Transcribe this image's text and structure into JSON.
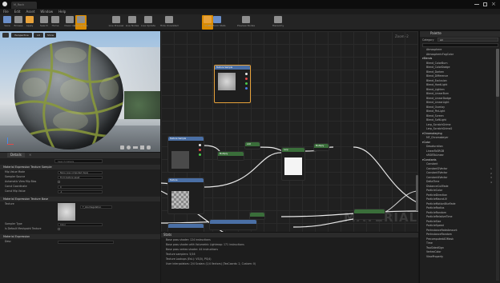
{
  "titlebar": {
    "tab": "M_Rock"
  },
  "menu": [
    "File",
    "Edit",
    "Asset",
    "Window",
    "Help"
  ],
  "toolbar": [
    {
      "label": "Save",
      "icon": "save-icon"
    },
    {
      "label": "Browse",
      "icon": "browse-icon"
    },
    {
      "label": "Apply",
      "icon": "apply-icon"
    },
    {
      "label": "Search",
      "icon": "search-icon"
    },
    {
      "label": "Home",
      "icon": "home-icon"
    },
    {
      "label": "Clean Up",
      "icon": "clean-up-icon"
    },
    {
      "label": "Connectors",
      "icon": "connectors-icon"
    },
    {
      "label": "Live Preview",
      "icon": "live-preview-icon"
    },
    {
      "label": "Live Nodes",
      "icon": "live-nodes-icon"
    },
    {
      "label": "Live Update",
      "icon": "live-update-icon"
    },
    {
      "label": "Hide Unrelated",
      "icon": "hide-unrelated-icon"
    },
    {
      "label": "Stats",
      "icon": "stats-icon"
    },
    {
      "label": "Platform Stats",
      "icon": "platform-stats-icon"
    },
    {
      "label": "Preview Nodes",
      "icon": "preview-nodes-icon"
    },
    {
      "label": "Hierarchy",
      "icon": "hierarchy-icon"
    }
  ],
  "viewport": {
    "mode": "Perspective",
    "lit": "Lit",
    "show": "Show"
  },
  "graph": {
    "zoom": "Zoom -2",
    "watermark": "MATERIAL"
  },
  "details": {
    "tab": "Details",
    "search_placeholder": "Search Details",
    "sections": [
      {
        "title": "Material Expression Texture Sample",
        "rows": [
          {
            "label": "Mip Value Mode",
            "value": "None (use computed mips)"
          },
          {
            "label": "Sampler Source",
            "value": "From texture asset"
          },
          {
            "label": "Automatic View Mip Bias",
            "value": ""
          },
          {
            "label": "Const Coordinate",
            "value": "0"
          },
          {
            "label": "Const Mip Value",
            "value": "-1"
          }
        ]
      },
      {
        "title": "Material Expression Texture Base",
        "rows": [
          {
            "label": "Texture",
            "value": "T_AlienVegetation"
          },
          {
            "label": "Sampler Type",
            "value": "Color"
          },
          {
            "label": "Is Default Meshpaint Texture",
            "value": ""
          }
        ]
      },
      {
        "title": "Material Expression",
        "rows": [
          {
            "label": "Desc",
            "value": ""
          }
        ]
      }
    ]
  },
  "palette": {
    "tab": "Palette",
    "category_label": "Category",
    "category_value": "All",
    "items": [
      {
        "cat": false,
        "text": "Atmosphere"
      },
      {
        "cat": false,
        "text": "AtmosphericFogColor"
      },
      {
        "cat": true,
        "text": "Blends"
      },
      {
        "cat": false,
        "text": "Blend_ColorBurn"
      },
      {
        "cat": false,
        "text": "Blend_ColorDodge"
      },
      {
        "cat": false,
        "text": "Blend_Darken"
      },
      {
        "cat": false,
        "text": "Blend_Difference"
      },
      {
        "cat": false,
        "text": "Blend_Exclusion"
      },
      {
        "cat": false,
        "text": "Blend_HardLight"
      },
      {
        "cat": false,
        "text": "Blend_Lighten"
      },
      {
        "cat": false,
        "text": "Blend_LinearBurn"
      },
      {
        "cat": false,
        "text": "Blend_LinearDodge"
      },
      {
        "cat": false,
        "text": "Blend_LinearLight"
      },
      {
        "cat": false,
        "text": "Blend_Overlay"
      },
      {
        "cat": false,
        "text": "Blend_PinLight"
      },
      {
        "cat": false,
        "text": "Blend_Screen"
      },
      {
        "cat": false,
        "text": "Blend_SoftLight"
      },
      {
        "cat": false,
        "text": "Lerp_ScratchGrime"
      },
      {
        "cat": false,
        "text": "Lerp_ScratchGrime2"
      },
      {
        "cat": true,
        "text": "Chromakeying"
      },
      {
        "cat": false,
        "text": "MF_Chromakeyer"
      },
      {
        "cat": true,
        "text": "Color"
      },
      {
        "cat": false,
        "text": "Desaturation"
      },
      {
        "cat": false,
        "text": "LinearToSRGB"
      },
      {
        "cat": false,
        "text": "sRGBToLinear"
      },
      {
        "cat": true,
        "text": "Constants"
      },
      {
        "cat": false,
        "text": "Constant"
      },
      {
        "cat": false,
        "text": "Constant2Vector"
      },
      {
        "cat": false,
        "text": "Constant3Vector"
      },
      {
        "cat": false,
        "text": "Constant4Vector"
      },
      {
        "cat": false,
        "text": "DeltaTime"
      },
      {
        "cat": false,
        "text": "DistanceCullFade"
      },
      {
        "cat": false,
        "text": "ParticleColor"
      },
      {
        "cat": false,
        "text": "ParticleDirection"
      },
      {
        "cat": false,
        "text": "ParticleMacroUV"
      },
      {
        "cat": false,
        "text": "ParticleMotionBlurFade"
      },
      {
        "cat": false,
        "text": "ParticleRadius"
      },
      {
        "cat": false,
        "text": "ParticleRandom"
      },
      {
        "cat": false,
        "text": "ParticleRelativeTime"
      },
      {
        "cat": false,
        "text": "ParticleSize"
      },
      {
        "cat": false,
        "text": "ParticleSpeed"
      },
      {
        "cat": false,
        "text": "PerInstanceFadeAmount"
      },
      {
        "cat": false,
        "text": "PerInstanceRandom"
      },
      {
        "cat": false,
        "text": "PrecomputedAOMask"
      },
      {
        "cat": false,
        "text": "Time"
      },
      {
        "cat": false,
        "text": "TwoSidedSign"
      },
      {
        "cat": false,
        "text": "VertexColor"
      },
      {
        "cat": false,
        "text": "ViewProperty"
      }
    ],
    "shortcuts": [
      "1",
      "2",
      "3",
      "4"
    ]
  },
  "stats": {
    "tab": "Stats",
    "lines": [
      "Base pass shader: 124 instructions",
      "Base pass shader with Volumetric Lightmap: 171 instructions",
      "Base pass vertex shader: 44 instructions",
      "Texture samplers: 5/16",
      "Texture Lookups (Est.): VS(0), PS(4)",
      "User interpolators: 2/4 Scalars (1/4 Vectors) (TexCoords: 2, Custom: 0)"
    ]
  },
  "nodes": [
    {
      "title": "Texture Sample",
      "color": "#4a6fa5"
    },
    {
      "title": "Multiply",
      "color": "#3a6e3a"
    },
    {
      "title": "Texture Sample",
      "color": "#4a6fa5"
    },
    {
      "title": "Add",
      "color": "#3a6e3a"
    },
    {
      "title": "Lerp",
      "color": "#3a6e3a"
    },
    {
      "title": "Texture",
      "color": "#4a6fa5"
    },
    {
      "title": "Multiply",
      "color": "#3a6e3a"
    }
  ],
  "colors": {
    "accent": "#d98a00",
    "selection": "#e8a23a"
  }
}
